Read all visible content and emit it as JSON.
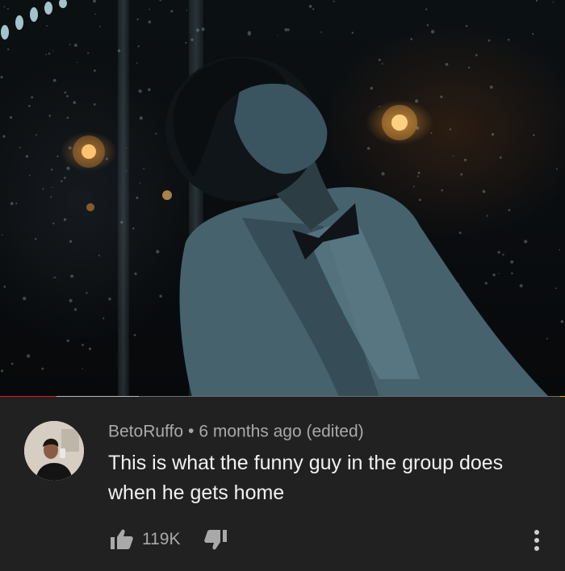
{
  "video": {
    "progress_played": 0.1,
    "progress_buffered": 0.245
  },
  "comment": {
    "author": "BetoRuffo",
    "separator": "•",
    "time": "6 months ago (edited)",
    "text": "This is what the funny guy in the group does when he gets home",
    "likes": "119K"
  },
  "icons": {
    "like": "thumbs-up-icon",
    "dislike": "thumbs-down-icon",
    "more": "vertical-ellipsis-icon"
  },
  "colors": {
    "background": "#212121",
    "progress_played": "#e61d25",
    "progress_marker": "#f5b400",
    "meta_text": "#a9a9a9",
    "comment_text": "#f1f1f1"
  }
}
